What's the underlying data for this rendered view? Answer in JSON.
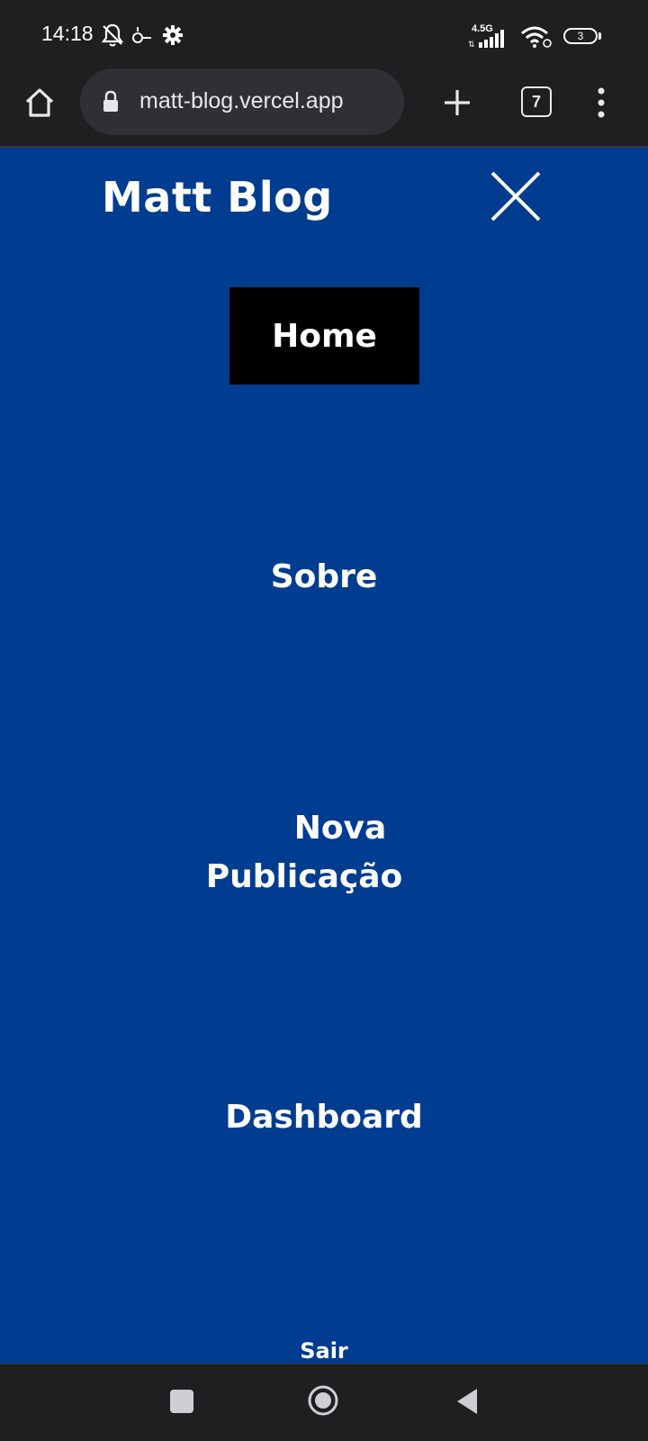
{
  "status_bar": {
    "time": "14:18",
    "network_label": "4.5G",
    "battery_level": "3",
    "icons": [
      "bell-off-icon",
      "key-icon",
      "gear-icon",
      "signal-icon",
      "wifi-icon",
      "battery-icon"
    ]
  },
  "browser": {
    "url": "matt-blog.vercel.app",
    "tab_count": "7",
    "icons": [
      "home-icon",
      "lock-icon",
      "plus-icon",
      "tabs-icon",
      "more-vert-icon"
    ]
  },
  "site": {
    "brand": "Matt Blog",
    "close_icon": "close-icon",
    "menu": {
      "home": "Home",
      "sobre": "Sobre",
      "nova_line1": "Nova",
      "nova_line2": "Publicação",
      "dashboard": "Dashboard",
      "sair": "Sair"
    }
  },
  "colors": {
    "background": "#003c8f",
    "active_item_bg": "#000000",
    "text": "#ffffff",
    "chrome": "#1f1f22"
  },
  "system_nav": {
    "icons": [
      "recents-icon",
      "home-circle-icon",
      "back-icon"
    ]
  }
}
